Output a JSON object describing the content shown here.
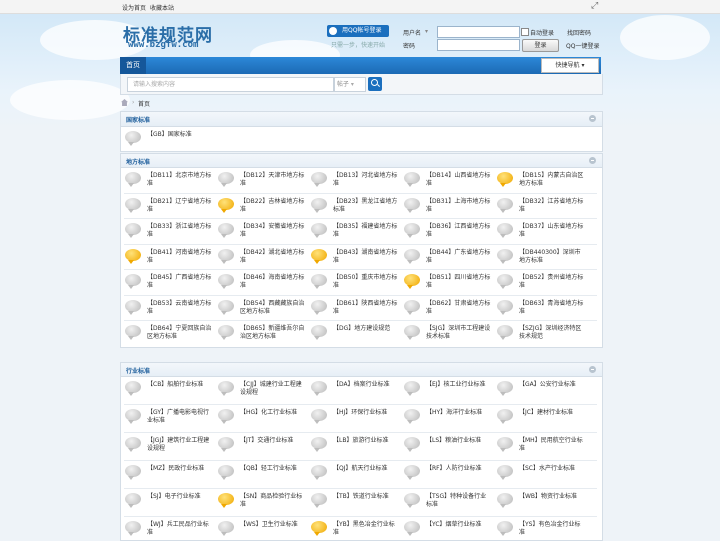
{
  "topbar": {
    "set_home": "设为首页",
    "bookmark": "收藏本站"
  },
  "brand": {
    "logo": "标准规范网",
    "url": "www.bzgfw.com"
  },
  "login": {
    "qq_login_button": "用QQ帐号登录",
    "qq_tip": "只需一步，快速开始",
    "username_label": "用户名",
    "password_label": "密码",
    "auto_login": "自动登录",
    "find_password": "找回密码",
    "login_button": "登录",
    "qq_quick_login": "QQ一键登录"
  },
  "nav": {
    "home": "首页",
    "quick_nav": "快捷导航"
  },
  "search": {
    "placeholder": "请输入搜索内容",
    "type_select": "帖子"
  },
  "breadcrumb": {
    "home": "首页"
  },
  "sections": [
    {
      "title": "国家标准",
      "items": [
        {
          "label": "【GB】国家标准",
          "yellow": false
        }
      ]
    },
    {
      "title": "地方标准",
      "items": [
        {
          "label": "【DB11】北京市地方标准",
          "yellow": false
        },
        {
          "label": "【DB12】天津市地方标准",
          "yellow": false
        },
        {
          "label": "【DB13】河北省地方标准",
          "yellow": false
        },
        {
          "label": "【DB14】山西省地方标准",
          "yellow": false
        },
        {
          "label": "【DB15】内蒙古自治区地方标准",
          "yellow": true
        },
        {
          "label": "【DB21】辽宁省地方标准",
          "yellow": false
        },
        {
          "label": "【DB22】吉林省地方标准",
          "yellow": true
        },
        {
          "label": "【DB23】黑龙江省地方标准",
          "yellow": false
        },
        {
          "label": "【DB31】上海市地方标准",
          "yellow": false
        },
        {
          "label": "【DB32】江苏省地方标准",
          "yellow": false
        },
        {
          "label": "【DB33】浙江省地方标准",
          "yellow": false
        },
        {
          "label": "【DB34】安徽省地方标准",
          "yellow": false
        },
        {
          "label": "【DB35】福建省地方标准",
          "yellow": false
        },
        {
          "label": "【DB36】江西省地方标准",
          "yellow": false
        },
        {
          "label": "【DB37】山东省地方标准",
          "yellow": false
        },
        {
          "label": "【DB41】河南省地方标准",
          "yellow": true
        },
        {
          "label": "【DB42】湖北省地方标准",
          "yellow": false
        },
        {
          "label": "【DB43】湖南省地方标准",
          "yellow": true
        },
        {
          "label": "【DB44】广东省地方标准",
          "yellow": false
        },
        {
          "label": "【DB440300】深圳市地方标准",
          "yellow": false
        },
        {
          "label": "【DB45】广西省地方标准",
          "yellow": false
        },
        {
          "label": "【DB46】海南省地方标准",
          "yellow": false
        },
        {
          "label": "【DB50】重庆市地方标准",
          "yellow": false
        },
        {
          "label": "【DB51】四川省地方标准",
          "yellow": true
        },
        {
          "label": "【DB52】贵州省地方标准",
          "yellow": false
        },
        {
          "label": "【DB53】云南省地方标准",
          "yellow": false
        },
        {
          "label": "【DB54】西藏藏族自治区地方标准",
          "yellow": false
        },
        {
          "label": "【DB61】陕西省地方标准",
          "yellow": false
        },
        {
          "label": "【DB62】甘肃省地方标准",
          "yellow": false
        },
        {
          "label": "【DB63】青海省地方标准",
          "yellow": false
        },
        {
          "label": "【DB64】宁夏回族自治区地方标准",
          "yellow": false
        },
        {
          "label": "【DB65】新疆维吾尔自治区地方标准",
          "yellow": false
        },
        {
          "label": "【DG】地方建设规范",
          "yellow": false
        },
        {
          "label": "【SJG】深圳市工程建设技术标准",
          "yellow": false
        },
        {
          "label": "【SZJG】深圳经济特区技术规范",
          "yellow": false
        }
      ]
    },
    {
      "title": "行业标准",
      "items": [
        {
          "label": "【CB】船舶行业标准",
          "yellow": false
        },
        {
          "label": "【CJJ】城建行业工程建设规程",
          "yellow": false
        },
        {
          "label": "【DA】档案行业标准",
          "yellow": false
        },
        {
          "label": "【EJ】核工业行业标准",
          "yellow": false
        },
        {
          "label": "【GA】公安行业标准",
          "yellow": false
        },
        {
          "label": "【GY】广播电影电视行业标准",
          "yellow": false
        },
        {
          "label": "【HG】化工行业标准",
          "yellow": false
        },
        {
          "label": "【HJ】环保行业标准",
          "yellow": false
        },
        {
          "label": "【HY】海洋行业标准",
          "yellow": false
        },
        {
          "label": "【JC】建材行业标准",
          "yellow": false
        },
        {
          "label": "【JGJ】建筑行业工程建设规程",
          "yellow": false
        },
        {
          "label": "【JT】交通行业标准",
          "yellow": false
        },
        {
          "label": "【LB】旅游行业标准",
          "yellow": false
        },
        {
          "label": "【LS】粮油行业标准",
          "yellow": false
        },
        {
          "label": "【MH】民用航空行业标准",
          "yellow": false
        },
        {
          "label": "【MZ】民政行业标准",
          "yellow": false
        },
        {
          "label": "【QB】轻工行业标准",
          "yellow": false
        },
        {
          "label": "【QJ】航天行业标准",
          "yellow": false
        },
        {
          "label": "【RF】人防行业标准",
          "yellow": false
        },
        {
          "label": "【SC】水产行业标准",
          "yellow": false
        },
        {
          "label": "【SJ】电子行业标准",
          "yellow": false
        },
        {
          "label": "【SN】商品检验行业标准",
          "yellow": true
        },
        {
          "label": "【TB】铁道行业标准",
          "yellow": false
        },
        {
          "label": "【TSG】特种设备行业标准",
          "yellow": false
        },
        {
          "label": "【WB】物资行业标准",
          "yellow": false
        },
        {
          "label": "【WJ】兵工民品行业标准",
          "yellow": false
        },
        {
          "label": "【WS】卫生行业标准",
          "yellow": false
        },
        {
          "label": "【YB】黑色冶金行业标准",
          "yellow": true
        },
        {
          "label": "【YC】烟草行业标准",
          "yellow": false
        },
        {
          "label": "【YS】有色冶金行业标准",
          "yellow": false
        }
      ]
    }
  ]
}
